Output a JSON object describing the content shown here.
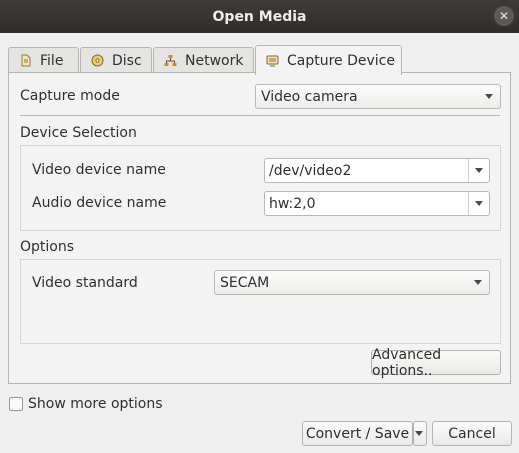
{
  "window": {
    "title": "Open Media",
    "close_glyph": "✕"
  },
  "tabs": [
    {
      "label": "File",
      "icon": "file-icon",
      "active": false
    },
    {
      "label": "Disc",
      "icon": "disc-icon",
      "active": false
    },
    {
      "label": "Network",
      "icon": "network-icon",
      "active": false
    },
    {
      "label": "Capture Device",
      "icon": "capture-device-icon",
      "active": true
    }
  ],
  "capture": {
    "mode_label": "Capture mode",
    "mode_value": "Video camera"
  },
  "device_selection": {
    "heading": "Device Selection",
    "video_label": "Video device name",
    "video_value": "/dev/video2",
    "audio_label": "Audio device name",
    "audio_value": "hw:2,0"
  },
  "options": {
    "heading": "Options",
    "standard_label": "Video standard",
    "standard_value": "SECAM",
    "advanced_button": "Advanced options.."
  },
  "footer": {
    "show_more": "Show more options",
    "show_more_checked": false,
    "convert_button": "Convert / Save",
    "cancel_button": "Cancel"
  },
  "colors": {
    "titlebar": "#2f2e2b",
    "window_bg": "#efefef",
    "panel_bg": "#f3f3f3"
  }
}
